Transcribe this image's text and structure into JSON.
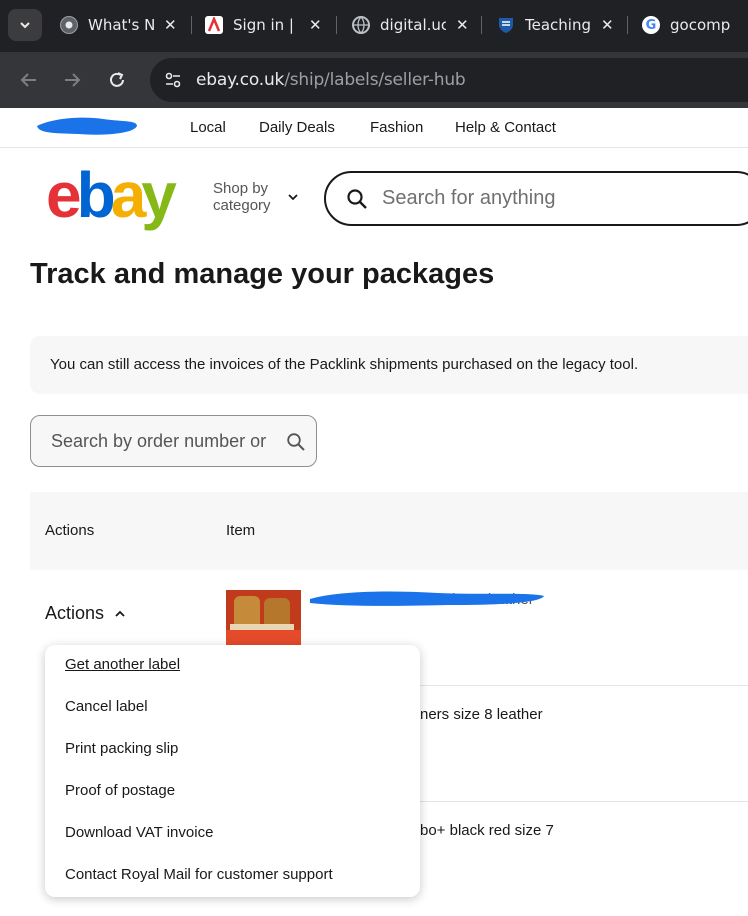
{
  "browser": {
    "tabs": [
      {
        "title": "What's N",
        "favicon": "chrome-icon"
      },
      {
        "title": "Sign in |",
        "favicon": "adobe-icon"
      },
      {
        "title": "digital.uc",
        "favicon": "globe-icon"
      },
      {
        "title": "Teaching",
        "favicon": "university-shield-icon"
      },
      {
        "title": "gocomp",
        "favicon": "google-icon"
      }
    ],
    "url_domain": "ebay.co.uk",
    "url_path": "/ship/labels/seller-hub"
  },
  "topnav": {
    "links": [
      "Local",
      "Daily Deals",
      "Fashion",
      "Help & Contact"
    ]
  },
  "header": {
    "logo": {
      "e": "e",
      "b": "b",
      "a": "a",
      "y": "y"
    },
    "shop_by_line1": "Shop by",
    "shop_by_line2": "category",
    "search_placeholder": "Search for anything"
  },
  "page": {
    "title": "Track and manage your packages",
    "banner": "You can still access the invoices of the Packlink shipments purchased on the legacy tool.",
    "order_search_placeholder": "Search by order number or"
  },
  "table": {
    "headers": [
      "Actions",
      "Item"
    ],
    "actions_label": "Actions",
    "rows": [
      {
        "item_visible_text": "o size 8 leather"
      },
      {
        "item_visible_text": "ners size 8 leather"
      },
      {
        "item_visible_text": "bo+ black red size 7"
      }
    ]
  },
  "menu": {
    "items": [
      "Get another label",
      "Cancel label",
      "Print packing slip",
      "Proof of postage",
      "Download VAT invoice",
      "Contact Royal Mail for customer support"
    ]
  },
  "colors": {
    "ebay_red": "#e53238",
    "ebay_blue": "#0064d2",
    "ebay_yellow": "#f5af02",
    "ebay_green": "#86b817",
    "redaction_blue": "#1a73e8"
  }
}
